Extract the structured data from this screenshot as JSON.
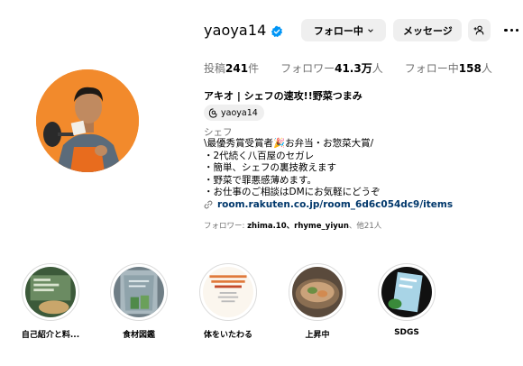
{
  "profile": {
    "username": "yaoya14",
    "verified": true
  },
  "actions": {
    "following_label": "フォロー中",
    "message_label": "メッセージ"
  },
  "stats": {
    "posts_label": "投稿",
    "posts_value": "241",
    "posts_unit": "件",
    "followers_label": "フォロワー",
    "followers_value": "41.3万",
    "followers_unit": "人",
    "following_label": "フォロー中",
    "following_value": "158",
    "following_unit": "人"
  },
  "bio": {
    "display_name": "アキオ | シェフの速攻!!野菜つまみ",
    "threads_handle": "yaoya14",
    "category": "シェフ",
    "lines": [
      "\\最優秀賞受賞者🎉お弁当・お惣菜大賞/",
      "・2代続く八百屋のセガレ",
      "・簡単、シェフの裏技教えます",
      "・野菜で罪悪感薄めます。",
      "・お仕事のご相談はDMにお気軽にどうぞ"
    ],
    "link": "room.rakuten.co.jp/room_6d6c054dc9/items"
  },
  "followed_by": {
    "prefix": "フォロワー: ",
    "users": "zhima.10、rhyme_yiyun",
    "suffix": "、他21人"
  },
  "highlights": [
    {
      "label": "自己紹介と料..."
    },
    {
      "label": "食材図鑑"
    },
    {
      "label": "体をいたわる"
    },
    {
      "label": "上昇中"
    },
    {
      "label": "SDGS"
    }
  ],
  "colors": {
    "accent_blue": "#0095f6",
    "link_blue": "#00376b",
    "muted": "#737373",
    "button_bg": "#efefef",
    "avatar_bg": "#f28a2c"
  }
}
